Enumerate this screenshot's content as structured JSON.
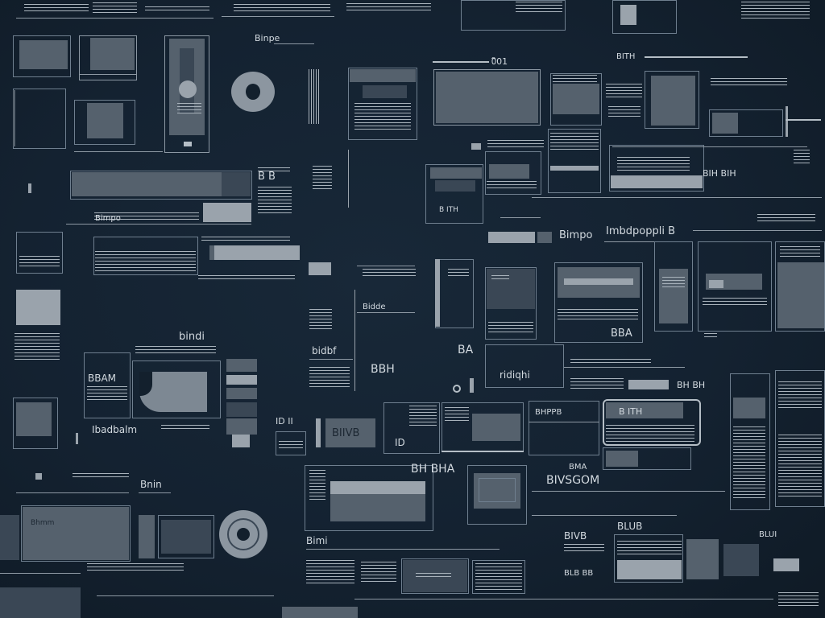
{
  "labels": {
    "top_left_small": "",
    "t01": "0ิ01",
    "t02": "B B",
    "t03": "Binpe",
    "t04": "BITH",
    "t05": "B ITH",
    "t06": "Bimpo",
    "t07": "Imbdpoppli B",
    "t08": "bindi",
    "t09": "bidbf",
    "t10": "BBAM",
    "t11": "Ibadbalm",
    "t12": "Bnin",
    "t13": "Bimi",
    "t14": "BIIVB",
    "t15": "BA",
    "t16": "BBH",
    "t17": "BBA",
    "t18": "ridiqhi",
    "t19": "BLUB",
    "t20": "BLB BB",
    "t21": "BIH BIH",
    "t22": "BH BH",
    "t23": "BH BHA",
    "t24": "BIVSGOM",
    "t25": "BIVB",
    "t26": "Bhmm",
    "t27": "BMA",
    "t28": "BHPPB",
    "t29": "Bidde",
    "t30": "ID",
    "t31": "ID II",
    "t32": "BLUI"
  },
  "colors": {
    "background": "#13202d",
    "panel_border": "#6f7f8f",
    "fill": "#6d7883",
    "fill_light": "#9aa3ac",
    "text": "#d3dae0"
  },
  "icons": {
    "donut_top": "donut-shape",
    "donut_bottom": "donut-shape",
    "blob": "rounded-blob-shape"
  }
}
